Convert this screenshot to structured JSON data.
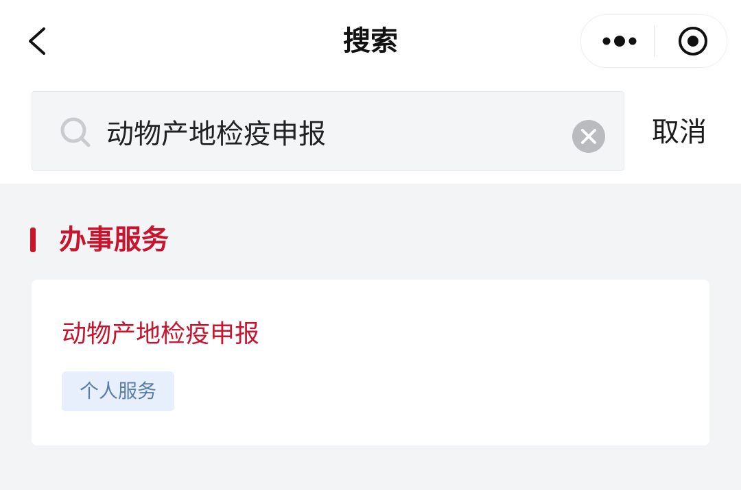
{
  "header": {
    "title": "搜索",
    "back_icon": "chevron-left-icon",
    "more_icon": "more-dots-icon",
    "close_icon": "target-circle-icon"
  },
  "search": {
    "value": "动物产地检疫申报",
    "placeholder": "",
    "icon": "search-icon",
    "clear_icon": "clear-circle-icon",
    "cancel_label": "取消"
  },
  "section": {
    "title": "办事服务"
  },
  "results": [
    {
      "title": "动物产地检疫申报",
      "tag": "个人服务"
    }
  ],
  "colors": {
    "accent_red": "#c8152d",
    "tag_bg": "#e6effb",
    "tag_text": "#5a7ea8",
    "content_bg": "#f3f4f6",
    "search_bg": "#f4f5f7"
  }
}
